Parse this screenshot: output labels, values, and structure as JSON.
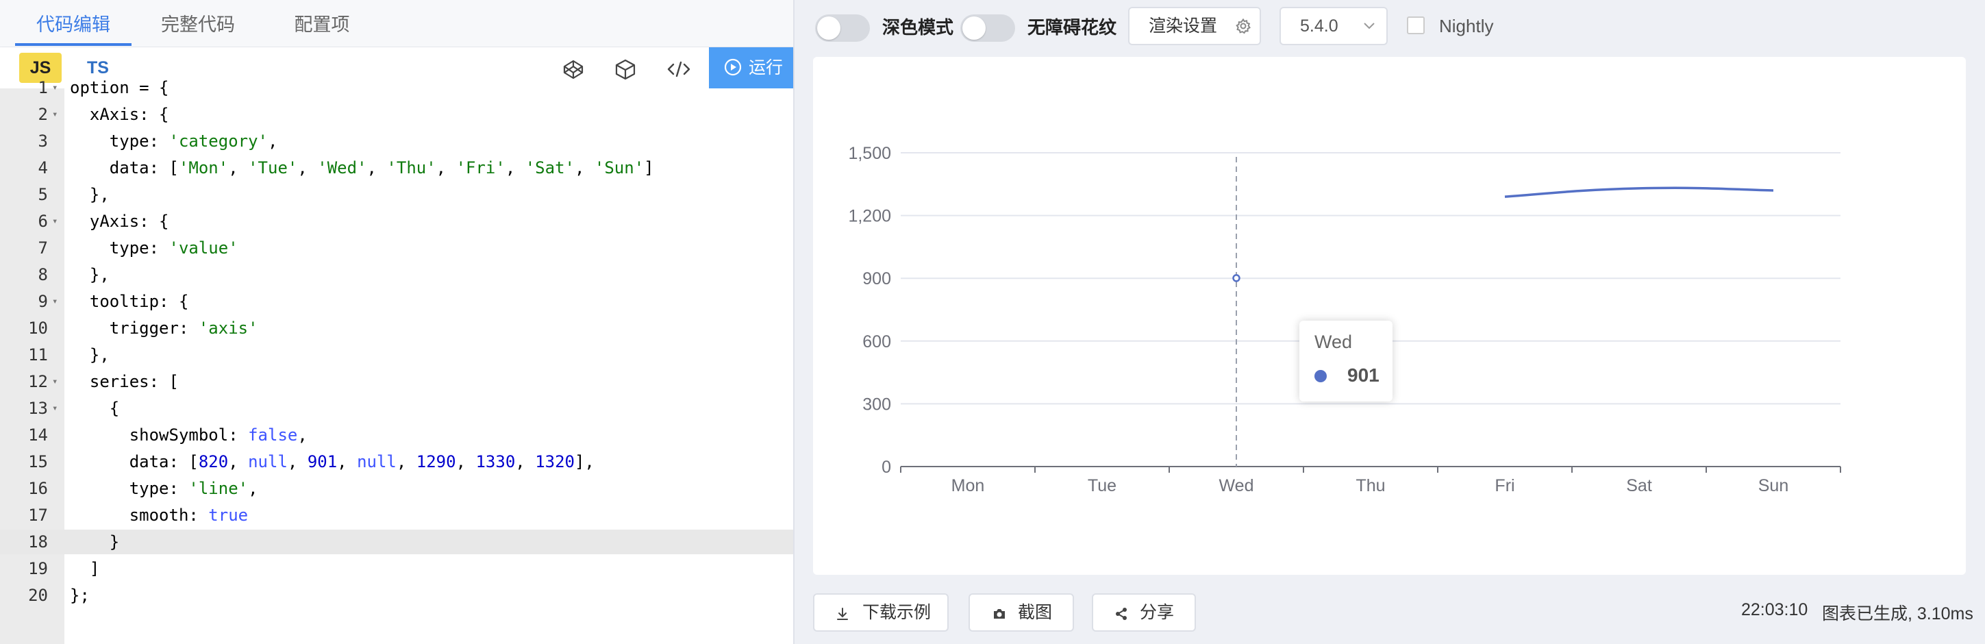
{
  "tabs": [
    {
      "label": "代码编辑",
      "active": true
    },
    {
      "label": "完整代码",
      "active": false
    },
    {
      "label": "配置项",
      "active": false
    }
  ],
  "toolbar": {
    "js_label": "JS",
    "ts_label": "TS",
    "icons": [
      "codepen-icon",
      "codesandbox-icon",
      "code-icon"
    ],
    "run_label": "运行"
  },
  "code_lines": [
    {
      "num": "1",
      "fold": true,
      "html": "option = {"
    },
    {
      "num": "2",
      "fold": true,
      "html": "  xAxis: {"
    },
    {
      "num": "3",
      "fold": false,
      "html": "    type: <span class='s'>'category'</span>,"
    },
    {
      "num": "4",
      "fold": false,
      "html": "    data: [<span class='s'>'Mon'</span>, <span class='s'>'Tue'</span>, <span class='s'>'Wed'</span>, <span class='s'>'Thu'</span>, <span class='s'>'Fri'</span>, <span class='s'>'Sat'</span>, <span class='s'>'Sun'</span>]"
    },
    {
      "num": "5",
      "fold": false,
      "html": "  },"
    },
    {
      "num": "6",
      "fold": true,
      "html": "  yAxis: {"
    },
    {
      "num": "7",
      "fold": false,
      "html": "    type: <span class='s'>'value'</span>"
    },
    {
      "num": "8",
      "fold": false,
      "html": "  },"
    },
    {
      "num": "9",
      "fold": true,
      "html": "  tooltip: {"
    },
    {
      "num": "10",
      "fold": false,
      "html": "    trigger: <span class='s'>'axis'</span>"
    },
    {
      "num": "11",
      "fold": false,
      "html": "  },"
    },
    {
      "num": "12",
      "fold": true,
      "html": "  series: ["
    },
    {
      "num": "13",
      "fold": true,
      "html": "    {"
    },
    {
      "num": "14",
      "fold": false,
      "html": "      showSymbol: <span class='k'>false</span>,"
    },
    {
      "num": "15",
      "fold": false,
      "html": "      data: [<span class='n'>820</span>, <span class='k'>null</span>, <span class='n'>901</span>, <span class='k'>null</span>, <span class='n'>1290</span>, <span class='n'>1330</span>, <span class='n'>1320</span>],"
    },
    {
      "num": "16",
      "fold": false,
      "html": "      type: <span class='s'>'line'</span>,"
    },
    {
      "num": "17",
      "fold": false,
      "html": "      smooth: <span class='k'>true</span>"
    },
    {
      "num": "18",
      "fold": false,
      "html": "    }"
    },
    {
      "num": "19",
      "fold": false,
      "html": "  ]"
    },
    {
      "num": "20",
      "fold": false,
      "html": "};"
    }
  ],
  "active_line": 18,
  "controls": {
    "dark_mode_label": "深色模式",
    "decal_label": "无障碍花纹",
    "render_settings_label": "渲染设置",
    "version_value": "5.4.0",
    "nightly_label": "Nightly"
  },
  "colors": {
    "accent": "#3d7de6",
    "run_button": "#4d9ef5",
    "series": "#5470c6"
  },
  "chart_data": {
    "type": "line",
    "categories": [
      "Mon",
      "Tue",
      "Wed",
      "Thu",
      "Fri",
      "Sat",
      "Sun"
    ],
    "series": [
      {
        "values": [
          820,
          null,
          901,
          null,
          1290,
          1330,
          1320
        ],
        "smooth": true,
        "showSymbol": false
      }
    ],
    "ylim": [
      0,
      1500
    ],
    "yticks": [
      0,
      300,
      600,
      900,
      1200,
      1500
    ],
    "ytick_labels": [
      "0",
      "300",
      "600",
      "900",
      "1,200",
      "1,500"
    ],
    "grid": true,
    "axis_pointer_category": "Wed",
    "tooltip": {
      "title": "Wed",
      "value": "901"
    }
  },
  "bottom": {
    "download_label": "下载示例",
    "screenshot_label": "截图",
    "share_label": "分享",
    "time": "22:03:10",
    "status": "图表已生成, 3.10ms"
  }
}
